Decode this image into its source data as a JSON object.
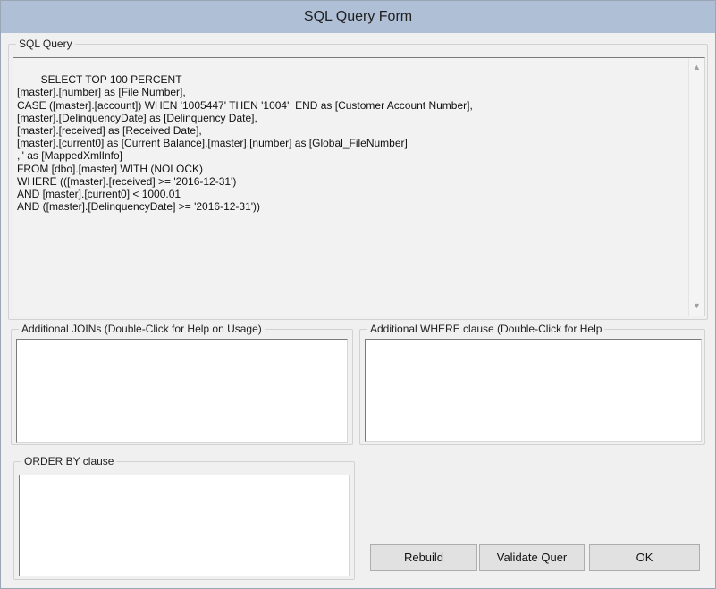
{
  "window": {
    "title": "SQL Query Form"
  },
  "sql_query": {
    "legend": "SQL Query",
    "text": "SELECT TOP 100 PERCENT\n[master].[number] as [File Number],\nCASE ([master].[account]) WHEN '1005447' THEN '1004'  END as [Customer Account Number],\n[master].[DelinquencyDate] as [Delinquency Date],\n[master].[received] as [Received Date],\n[master].[current0] as [Current Balance],[master].[number] as [Global_FileNumber]\n,'' as [MappedXmlInfo]\nFROM [dbo].[master] WITH (NOLOCK)\nWHERE (([master].[received] >= '2016-12-31')\nAND [master].[current0] < 1000.01\nAND ([master].[DelinquencyDate] >= '2016-12-31'))"
  },
  "joins": {
    "legend": "Additional JOINs (Double-Click for Help on Usage)",
    "value": ""
  },
  "where": {
    "legend": "Additional WHERE clause  (Double-Click for Help",
    "value": ""
  },
  "order_by": {
    "legend": "ORDER BY clause",
    "value": ""
  },
  "buttons": {
    "rebuild": "Rebuild",
    "validate": "Validate Quer",
    "ok": "OK"
  }
}
